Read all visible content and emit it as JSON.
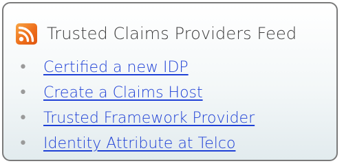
{
  "feed": {
    "title": "Trusted Claims Providers Feed",
    "icon": "rss-icon",
    "icon_color": "#ee6f1c",
    "link_color": "#1d3fd6",
    "items": [
      {
        "bullet": "•",
        "label": "Certified a new IDP"
      },
      {
        "bullet": "•",
        "label": "Create a Claims Host"
      },
      {
        "bullet": "•",
        "label": "Trusted Framework Provider"
      },
      {
        "bullet": "•",
        "label": "Identity Attribute at Telco"
      }
    ]
  }
}
